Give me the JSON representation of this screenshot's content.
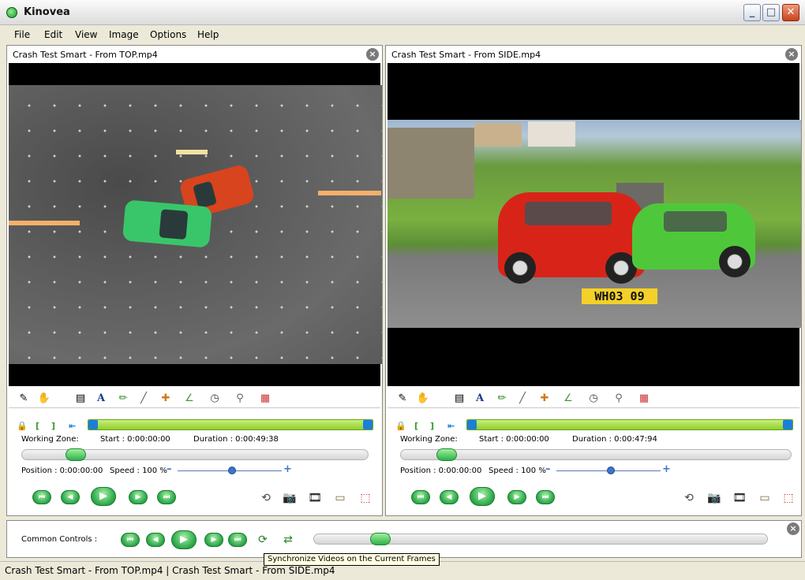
{
  "window": {
    "title": "Kinovea",
    "minimize": "_",
    "maximize": "□",
    "close": "✕"
  },
  "menu": [
    "File",
    "Edit",
    "View",
    "Image",
    "Options",
    "Help"
  ],
  "panels": [
    {
      "title": "Crash Test Smart - From TOP.mp4",
      "working_zone_label": "Working Zone:",
      "start": "Start : 0:00:00:00",
      "duration": "Duration : 0:00:49:38",
      "position": "Position : 0:00:00:00",
      "speed": "Speed : 100 %"
    },
    {
      "title": "Crash Test Smart - From SIDE.mp4",
      "working_zone_label": "Working Zone:",
      "start": "Start : 0:00:00:00",
      "duration": "Duration : 0:00:47:94",
      "position": "Position : 0:00:00:00",
      "speed": "Speed : 100 %",
      "plate": "WH03 09"
    }
  ],
  "common": {
    "label": "Common Controls :",
    "tooltip": "Synchronize Videos on the Current Frames"
  },
  "status": "Crash Test Smart - From TOP.mp4 | Crash Test Smart - From SIDE.mp4",
  "glyphs": {
    "close": "×",
    "first": "⏮",
    "prev": "◀",
    "play": "▶",
    "next": "▶",
    "last": "⏭",
    "minus": "–",
    "plus": "+",
    "text_tool": "A",
    "lock": "🔒",
    "bracket_open": "[",
    "bracket_close": "]",
    "jump": "⇤",
    "new_key": "✎",
    "hand": "✋",
    "page": "▤",
    "pencil": "✏",
    "line": "╱",
    "cross": "✚",
    "angle": "∠",
    "chrono": "◷",
    "zoom": "⚲",
    "grid": "▦",
    "reset": "⟲",
    "camera": "📷",
    "film": "🎞",
    "presentation": "▭",
    "pdf": "⬚",
    "sync": "⟳",
    "swap": "⇄"
  }
}
